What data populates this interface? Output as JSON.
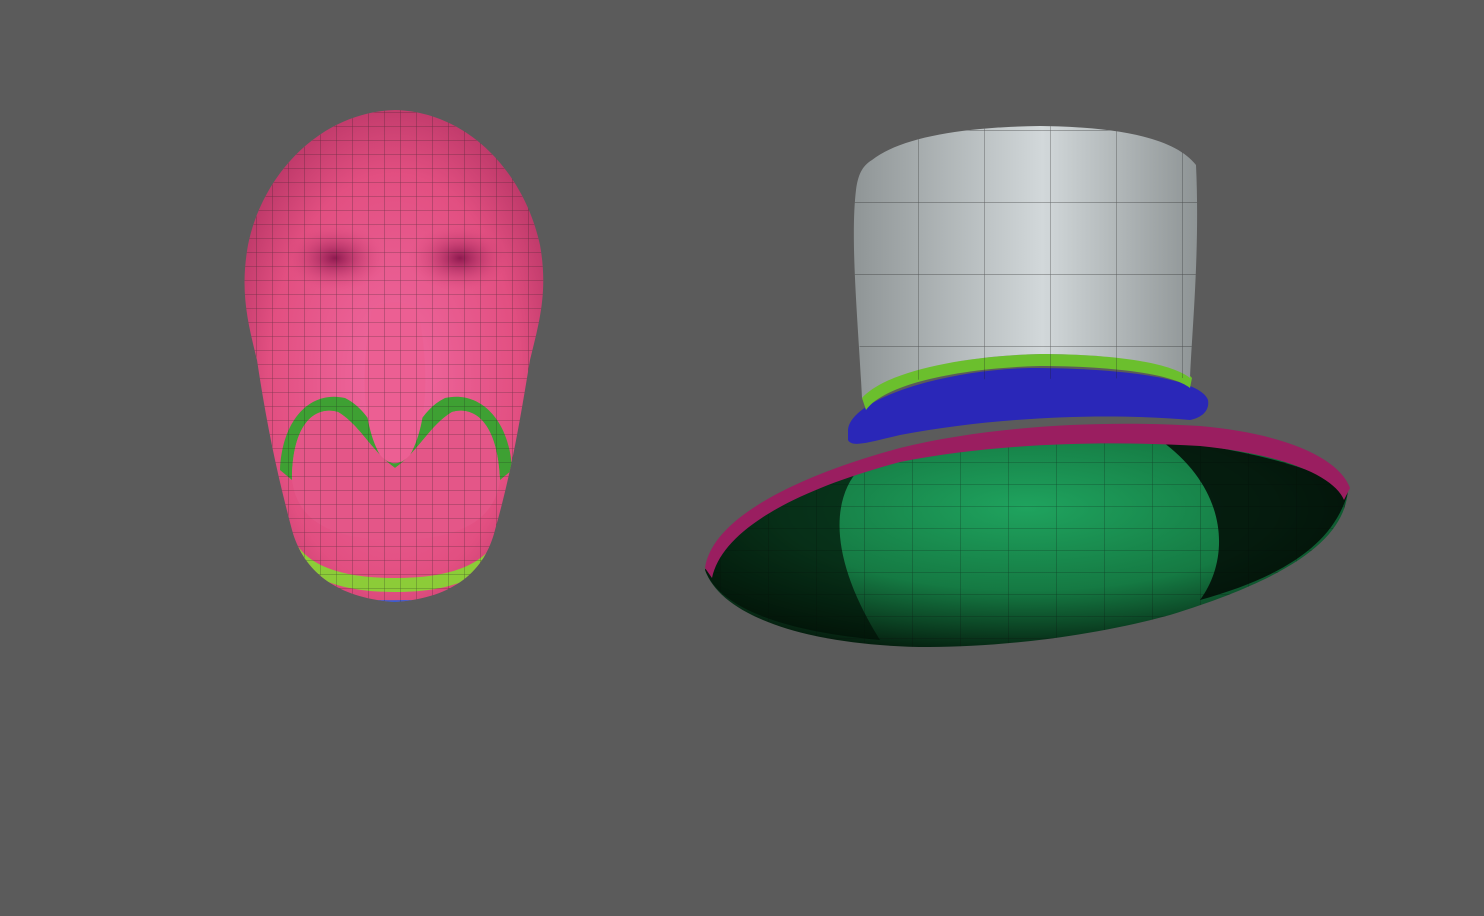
{
  "viewport": {
    "background": "#5b5b5b",
    "wire_color": "#1d1d1d"
  },
  "objects": [
    {
      "name": "head-mesh",
      "polygroups": {
        "skin": "#e24f81",
        "skin_highlight": "#f06aa1",
        "eye_socket": "#a8245f",
        "lip_ring": "#3ea033",
        "chin_band": "#8ccc38",
        "edge": "#2f5fd6"
      }
    },
    {
      "name": "top-hat-mesh",
      "polygroups": {
        "crown": "#c9cfd1",
        "crown_shade": "#8f9596",
        "band_thin": "#6bbf2d",
        "band": "#2a27b8",
        "brim_edge": "#9a1e60",
        "brim_under": "#1f9a57",
        "brim_dark": "#0c3a1f"
      }
    }
  ]
}
